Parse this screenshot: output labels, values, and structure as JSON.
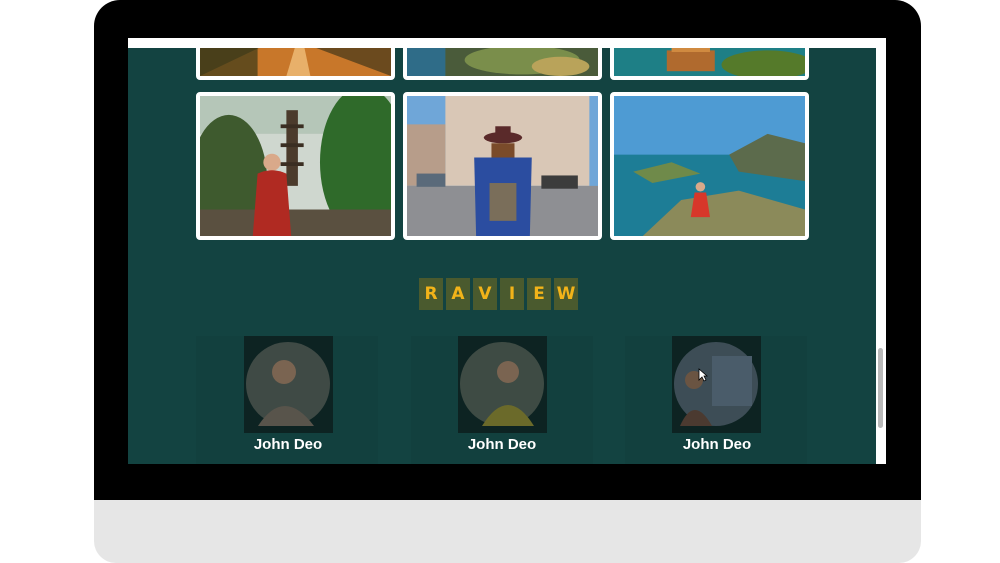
{
  "section": {
    "heading_letters": [
      "R",
      "A",
      "V",
      "I",
      "E",
      "W"
    ]
  },
  "reviews": [
    {
      "name": "John Deo",
      "avatar": "man-with-phone-avatar"
    },
    {
      "name": "John Deo",
      "avatar": "woman-smiling-avatar"
    },
    {
      "name": "John Deo",
      "avatar": "person-in-city-avatar"
    }
  ],
  "gallery": [
    {
      "name": "gallery-photo-forest-road"
    },
    {
      "name": "gallery-photo-coastline"
    },
    {
      "name": "gallery-photo-island-village"
    },
    {
      "name": "gallery-photo-temple-woman"
    },
    {
      "name": "gallery-photo-street-woman"
    },
    {
      "name": "gallery-photo-island-viewpoint"
    }
  ],
  "colors": {
    "page_background": "#134341",
    "heading_letter_bg": "#4a5a2e",
    "heading_letter_text": "#f2b319"
  }
}
